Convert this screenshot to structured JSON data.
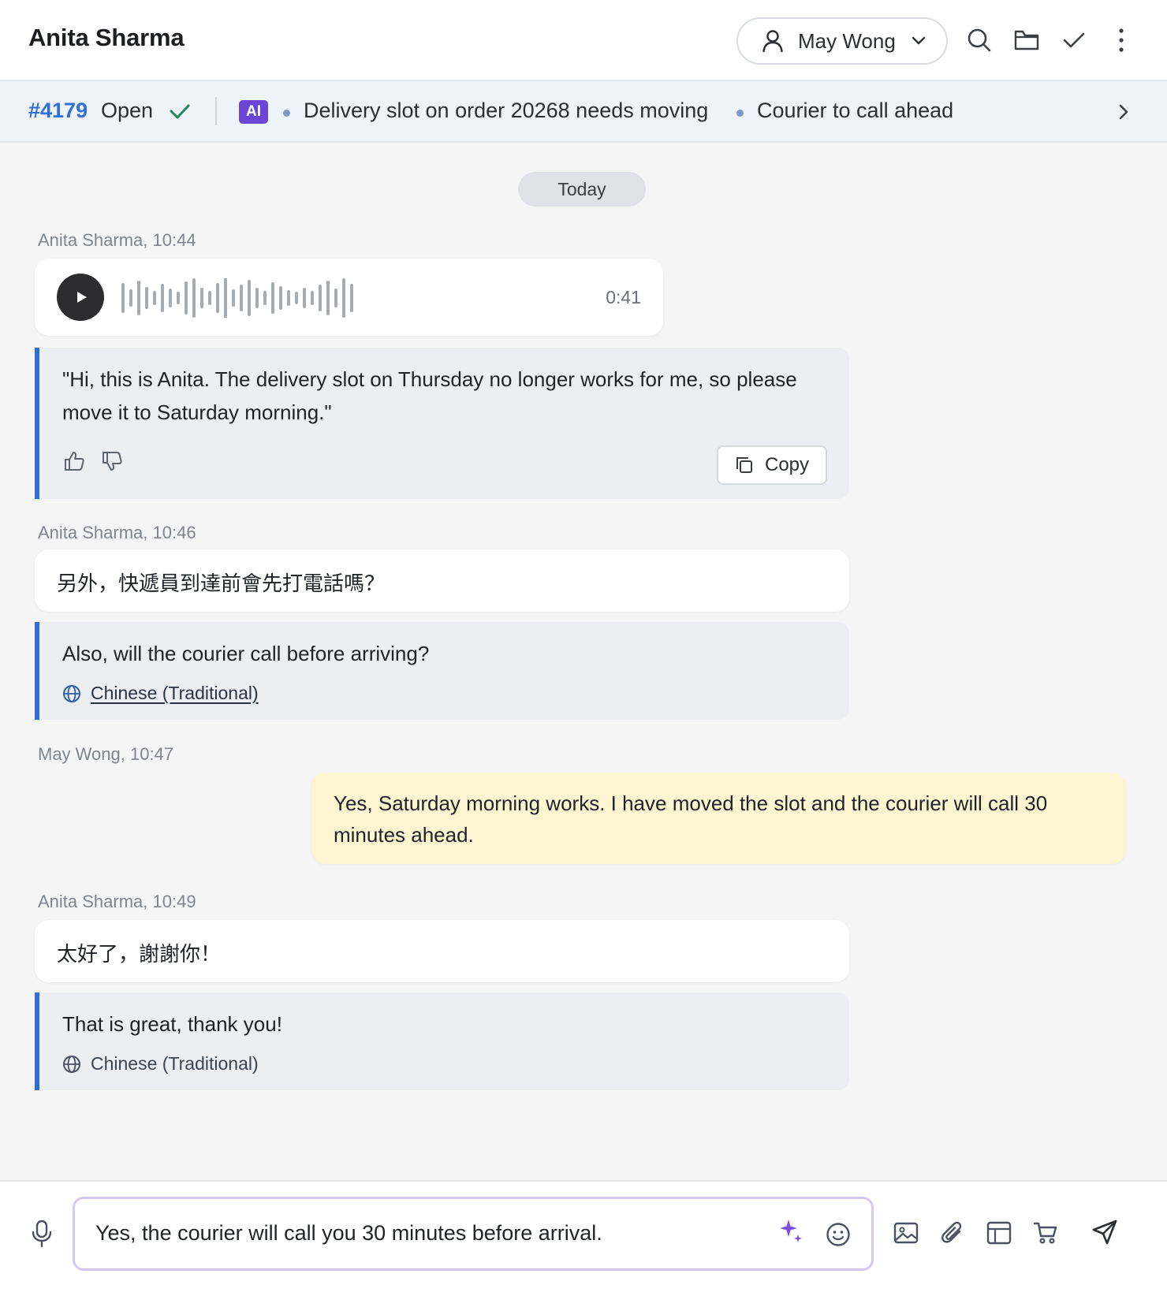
{
  "header": {
    "title": "Anita Sharma",
    "assignee": "May Wong"
  },
  "ticket": {
    "id": "#4179",
    "status": "Open",
    "ai_badge": "AI",
    "summary": [
      "Delivery slot on order 20268 needs moving",
      "Courier to call ahead"
    ]
  },
  "conversation": {
    "date_divider": "Today",
    "voice_meta": "Anita Sharma, 10:44",
    "voice_duration": "0:41",
    "voice_transcript": "\"Hi, this is Anita. The delivery slot on Thursday no longer works for me, so please move it to Saturday morning.\"",
    "copy_label": "Copy",
    "msg2_meta": "Anita Sharma, 10:46",
    "msg2_text": "另外，快遞員到達前會先打電話嗎？",
    "msg2_translation": "Also, will the courier call before arriving?",
    "msg2_language": "Chinese (Traditional)",
    "agent_meta": "May Wong, 10:47",
    "agent_text": "Yes, Saturday morning works. I have moved the slot and the courier will call 30 minutes ahead.",
    "msg3_meta": "Anita Sharma, 10:49",
    "msg3_text": "太好了，謝謝你！",
    "msg3_translation": "That is great, thank you!",
    "msg3_language": "Chinese (Traditional)"
  },
  "composer": {
    "draft": "Yes, the courier will call you 30 minutes before arrival."
  },
  "icons": [
    "person-icon",
    "chevron-down-icon",
    "search-icon",
    "folder-icon",
    "check-icon",
    "more-icon",
    "play-icon",
    "thumbs-up-icon",
    "thumbs-down-icon",
    "copy-icon",
    "globe-icon",
    "microphone-icon",
    "sparkle-icon",
    "emoji-icon",
    "image-icon",
    "paperclip-icon",
    "template-icon",
    "cart-icon",
    "send-icon"
  ],
  "colors": {
    "accent": "#2f6fd6",
    "ai_badge": "#6d45d6",
    "status_check": "#1e8a5a",
    "agent_bubble": "#fdf4d2",
    "translation_bg": "#eceef3"
  }
}
